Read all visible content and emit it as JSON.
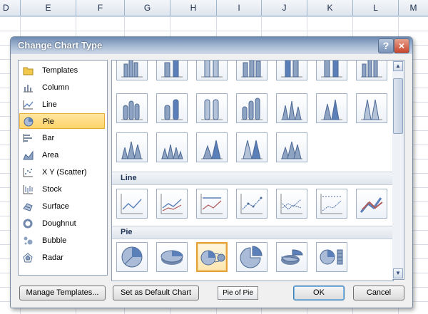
{
  "sheet": {
    "columns": [
      "D",
      "E",
      "F",
      "G",
      "H",
      "I",
      "J",
      "K",
      "L",
      "M"
    ]
  },
  "dialog": {
    "title": "Change Chart Type",
    "help_label": "?",
    "close_label": "×"
  },
  "chart_types": [
    {
      "label": "Templates",
      "icon": "folder-icon"
    },
    {
      "label": "Column",
      "icon": "column-chart-icon"
    },
    {
      "label": "Line",
      "icon": "line-chart-icon"
    },
    {
      "label": "Pie",
      "icon": "pie-chart-icon",
      "selected": true
    },
    {
      "label": "Bar",
      "icon": "bar-chart-icon"
    },
    {
      "label": "Area",
      "icon": "area-chart-icon"
    },
    {
      "label": "X Y (Scatter)",
      "icon": "scatter-chart-icon"
    },
    {
      "label": "Stock",
      "icon": "stock-chart-icon"
    },
    {
      "label": "Surface",
      "icon": "surface-chart-icon"
    },
    {
      "label": "Doughnut",
      "icon": "doughnut-chart-icon"
    },
    {
      "label": "Bubble",
      "icon": "bubble-chart-icon"
    },
    {
      "label": "Radar",
      "icon": "radar-chart-icon"
    }
  ],
  "gallery": {
    "sections": {
      "line": "Line",
      "pie": "Pie"
    },
    "selected_subtype": "Pie of Pie"
  },
  "buttons": {
    "manage_templates": "Manage Templates...",
    "set_default": "Set as Default Chart",
    "ok": "OK",
    "cancel": "Cancel"
  },
  "tooltip": "Pie of Pie",
  "colors": {
    "accent": "#e3a23a",
    "title_bar": "#6d8ab3",
    "chart_blue": "#5b7fb8"
  }
}
